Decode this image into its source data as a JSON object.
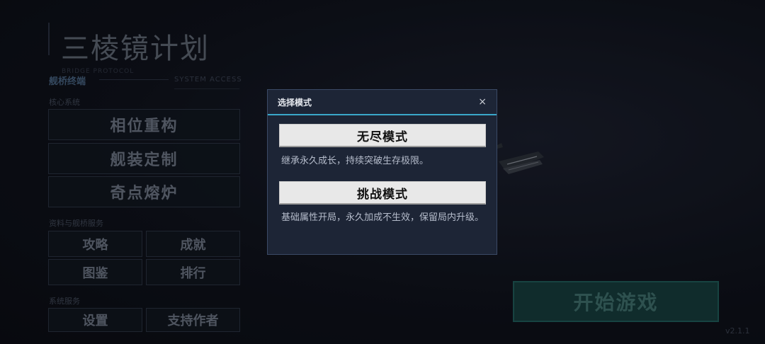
{
  "game": {
    "title": "三棱镜计划",
    "version": "v2.1.1",
    "start_label": "开始游戏"
  },
  "menu": {
    "bridge_label": "舰桥终端",
    "ghost_label": "BRIDGE PROTOCOL",
    "system_access_label": "SYSTEM ACCESS",
    "core_section": "核心系统",
    "core_buttons": [
      "相位重构",
      "舰装定制",
      "奇点熔炉"
    ],
    "service_section": "资料与舰桥服务",
    "service_buttons": [
      "攻略",
      "成就",
      "图鉴",
      "排行"
    ],
    "system_section": "系统服务",
    "system_buttons": [
      "设置",
      "支持作者"
    ]
  },
  "modal": {
    "title": "选择模式",
    "close_glyph": "×",
    "modes": [
      {
        "label": "无尽模式",
        "desc": "继承永久成长，持续突破生存极限。"
      },
      {
        "label": "挑战模式",
        "desc": "基础属性开局，永久加成不生效，保留局内升级。"
      }
    ]
  },
  "colors": {
    "accent": "#3aa7c9",
    "start_button": "#163b3b",
    "modal_bg": "#1d2536"
  }
}
